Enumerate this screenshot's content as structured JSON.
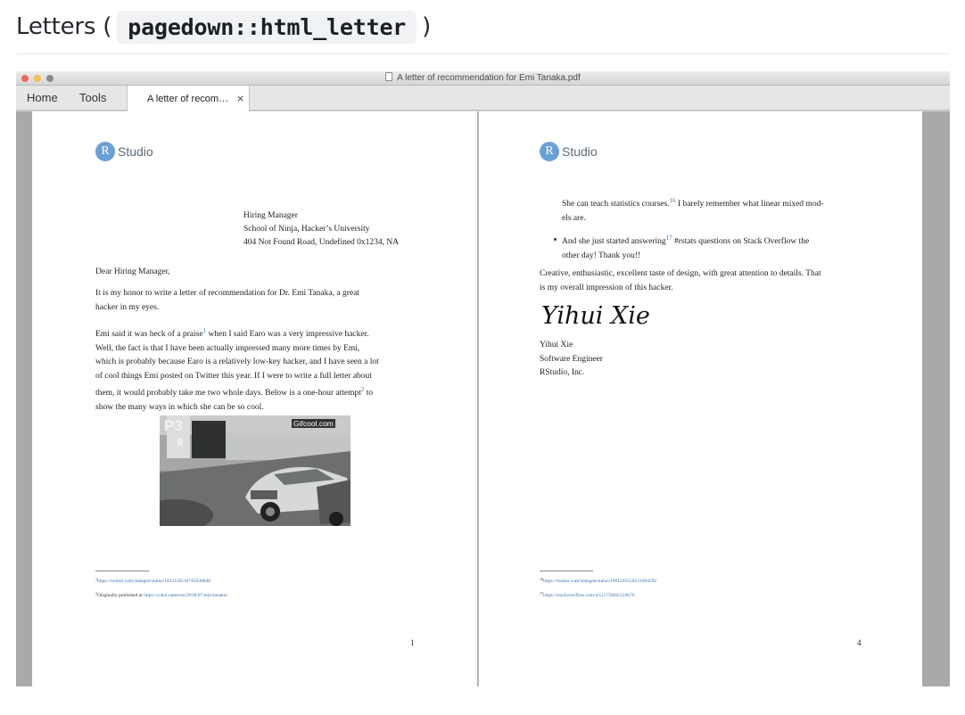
{
  "heading": {
    "prefix": "Letters (",
    "code": "pagedown::html_letter",
    "suffix": ")"
  },
  "window": {
    "title": "A letter of recommendation for Emi Tanaka.pdf"
  },
  "tabs": {
    "home": "Home",
    "tools": "Tools",
    "active": "A letter of recom…",
    "close": "×"
  },
  "page1": {
    "logo": {
      "r": "R",
      "studio": "Studio"
    },
    "address": [
      "Hiring Manager",
      "School of Ninja, Hacker’s University",
      "404 Not Found Road, Undefined 0x1234, NA"
    ],
    "salutation": "Dear Hiring Manager,",
    "para1": [
      "It is my honor to write a letter of recommendation for Dr. Emi Tanaka, a great",
      "hacker in my eyes."
    ],
    "para2": {
      "l1a": "Emi said it was heck of a praise",
      "l1sup": "1",
      "l1b": " when I said Earo was a very impressive hacker.",
      "l2": "Well, the fact is that I have been actually impressed many more times by Emi,",
      "l3": "which is probably because Earo is a relatively low-key hacker, and I have seen a lot",
      "l4": "of cool things Emi posted on Twitter this year. If I were to write a full letter about",
      "l5a": "them, it would probably take me two whole days. Below is a one-hour attempt",
      "l5sup": "2",
      "l5b": " to",
      "l6": "show the many ways in which she can be so cool."
    },
    "image": {
      "tag": "P3",
      "watermark": "Gifcool.com"
    },
    "footnotes": {
      "f1num": "1",
      "f1url": "https://twitter.com/statsgen/status/1023118510745038848",
      "f2num": "2",
      "f2text": "Originally published at ",
      "f2url": "https://yihui.name/en/2018/07/emi-tanaka/",
      "f2end": "."
    },
    "number": "1"
  },
  "page4": {
    "logo": {
      "r": "R",
      "studio": "Studio"
    },
    "cont": {
      "l1a": "She can teach statistics courses.",
      "l1sup": "16",
      "l1b": " I barely remember what linear mixed mod-",
      "l2": "els are."
    },
    "bullet": {
      "l1a": "And she just started answering",
      "l1sup": "17",
      "l1b": " #rstats questions on Stack Overflow the",
      "l2": "other day! Thank you!!"
    },
    "closing": [
      "Creative, enthusiastic, excellent taste of design, with great attention to details. That",
      "is my overall impression of this hacker."
    ],
    "signature": "Yihui Xie",
    "signer": [
      "Yihui Xie",
      "Software Engineer",
      "RStudio, Inc."
    ],
    "footnotes": {
      "f16num": "16",
      "f16url": "https://twitter.com/statsgen/status/1001293550531694592",
      "f17num": "17",
      "f17url": "https://stackoverflow.com/a/51575804/559676"
    },
    "number": "4"
  },
  "colors": {
    "traffic_close": "#ee6a5e",
    "traffic_min": "#f5bf4f",
    "traffic_max": "#8a8a8a",
    "link": "#3a6fb0",
    "rstudio_blue": "#6aa0d6"
  }
}
